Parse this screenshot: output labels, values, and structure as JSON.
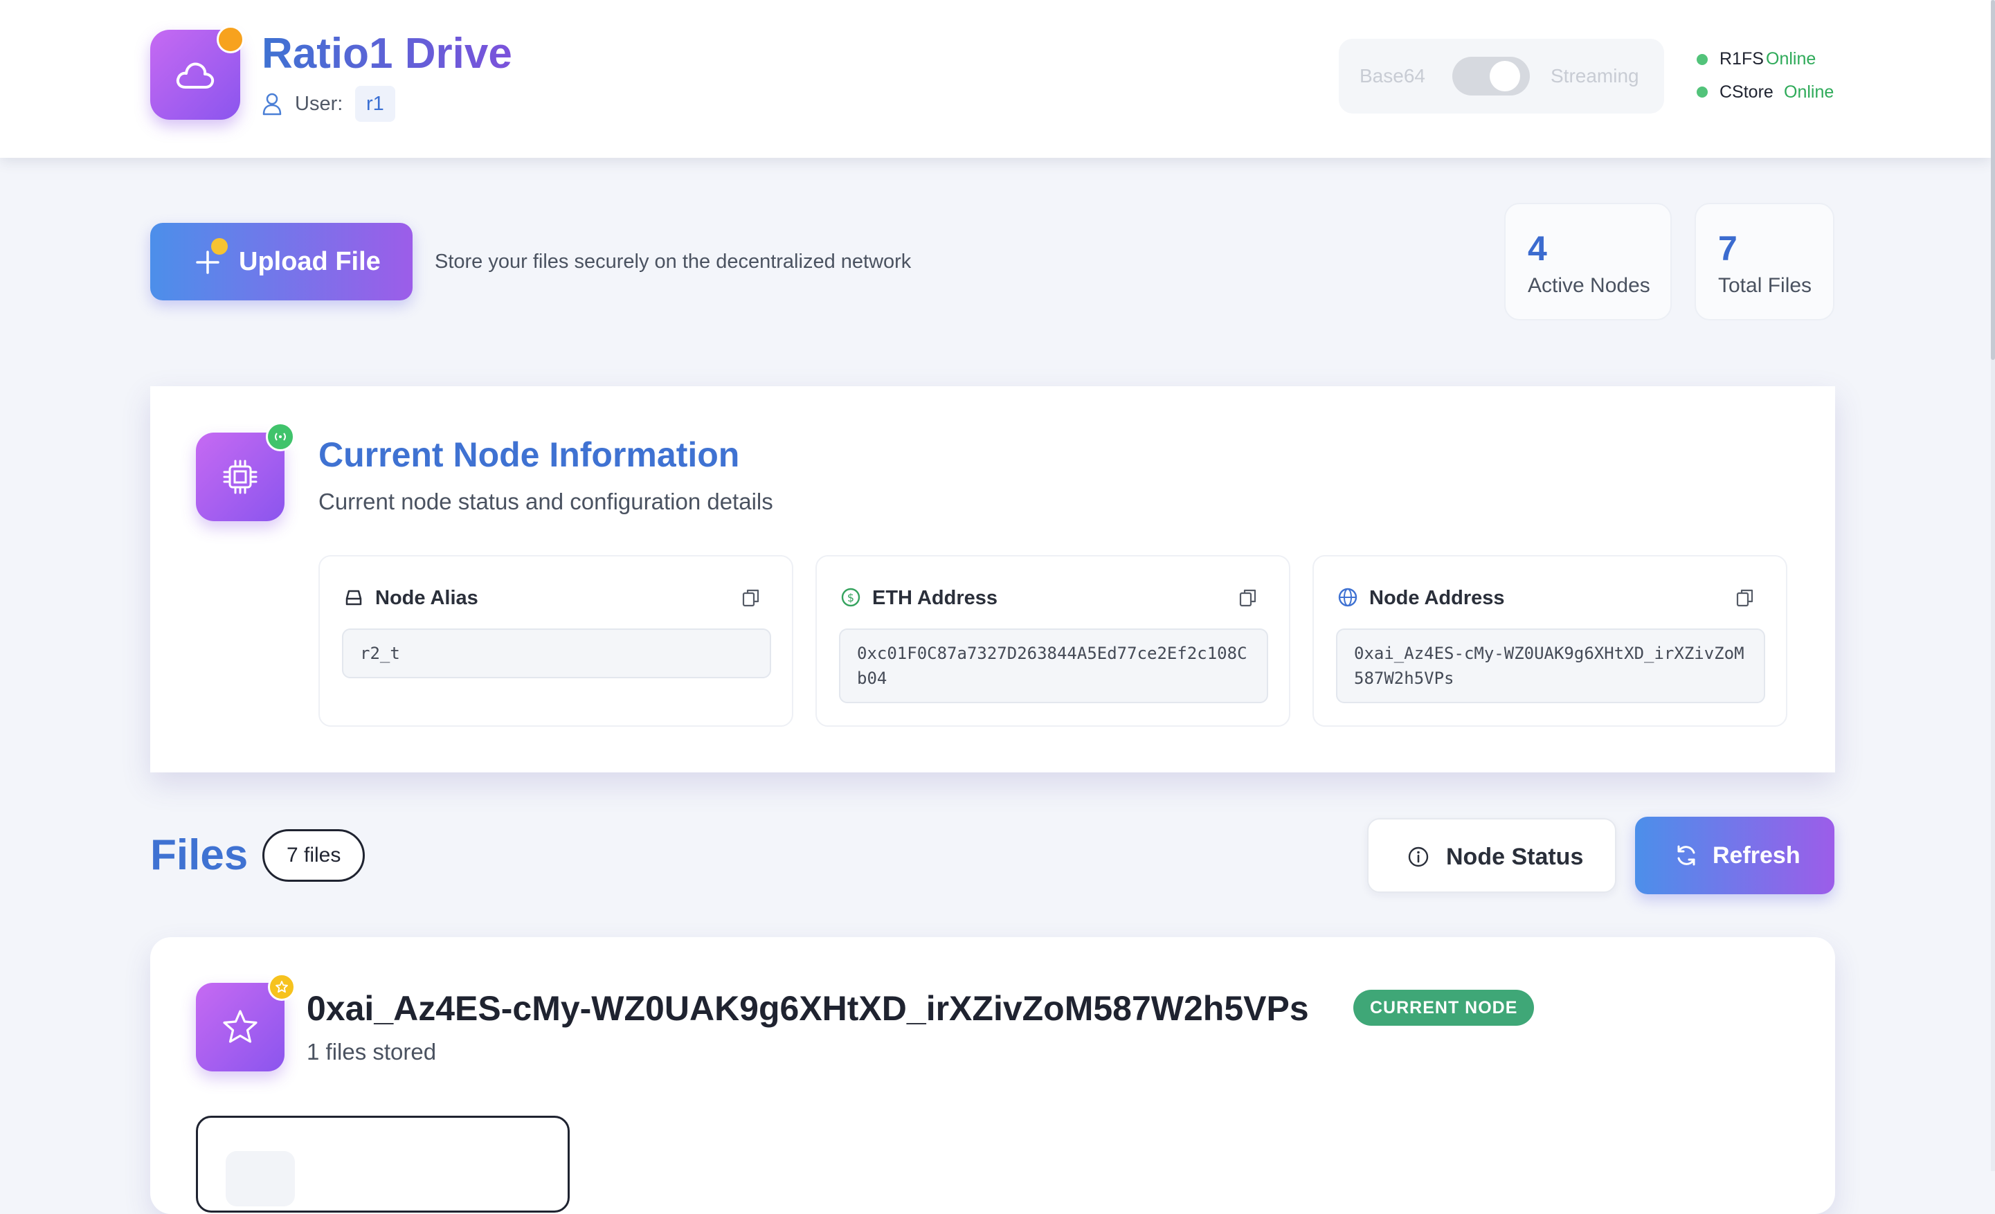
{
  "app": {
    "title": "Ratio1 Drive",
    "user_label": "User:",
    "user_name": "r1",
    "logo_icon": "cloud-icon"
  },
  "mode_toggle": {
    "left_label": "Base64",
    "right_label": "Streaming",
    "enabled": false
  },
  "services": [
    {
      "name": "R1FS",
      "status": "Online",
      "status_color": "#2eaa59"
    },
    {
      "name": "CStore",
      "status": "Online",
      "status_color": "#2eaa59"
    }
  ],
  "upload": {
    "button_label": "Upload File",
    "description": "Store your files securely on the decentralized network"
  },
  "stats": [
    {
      "value": "4",
      "label": "Active Nodes"
    },
    {
      "value": "7",
      "label": "Total Files"
    }
  ],
  "node_info": {
    "title": "Current Node Information",
    "subtitle": "Current node status and configuration details",
    "fields": [
      {
        "label": "Node Alias",
        "value": "r2_t",
        "icon": "drive-icon"
      },
      {
        "label": "ETH Address",
        "value": "0xc01F0C87a7327D263844A5Ed77ce2Ef2c108Cb04",
        "icon": "dollar-icon"
      },
      {
        "label": "Node Address",
        "value": "0xai_Az4ES-cMy-WZ0UAK9g6XHtXD_irXZivZoM587W2h5VPs",
        "icon": "globe-icon"
      }
    ]
  },
  "files": {
    "title": "Files",
    "count_chip": "7 files",
    "node_status_label": "Node Status",
    "refresh_label": "Refresh"
  },
  "node_files": {
    "node_address": "0xai_Az4ES-cMy-WZ0UAK9g6XHtXD_irXZivZoM587W2h5VPs",
    "badge": "CURRENT NODE",
    "count_text": "1 files stored"
  },
  "colors": {
    "accent_blue": "#3f72d2",
    "accent_purple": "#8b55ee",
    "online_green": "#2eaa59",
    "badge_green": "#3fa777"
  }
}
